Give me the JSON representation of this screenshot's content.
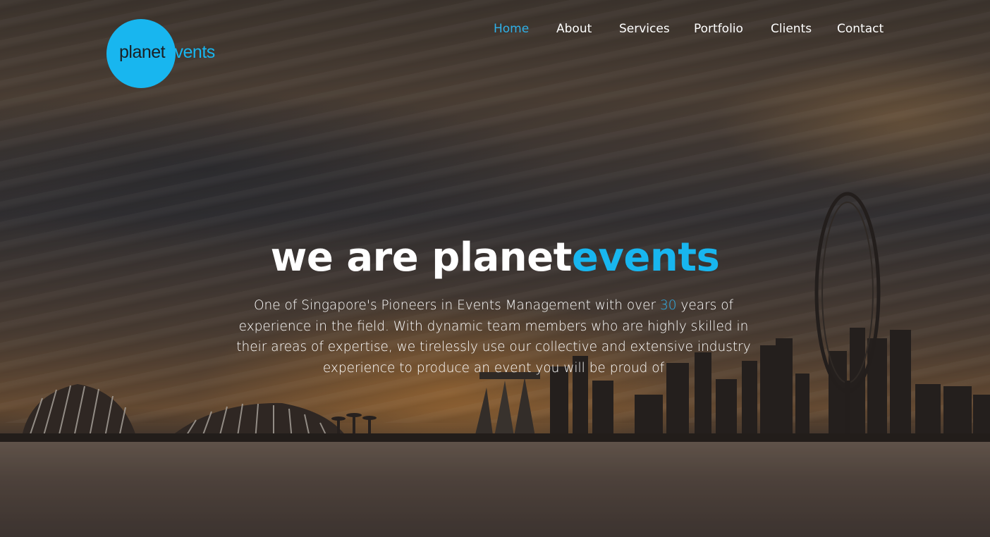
{
  "logo": {
    "text_dark": "planet",
    "text_accent": "events"
  },
  "nav": {
    "items": [
      {
        "label": "Home",
        "active": true
      },
      {
        "label": "About",
        "active": false
      },
      {
        "label": "Services",
        "active": false
      },
      {
        "label": "Portfolio",
        "active": false
      },
      {
        "label": "Clients",
        "active": false
      },
      {
        "label": "Contact",
        "active": false
      }
    ]
  },
  "hero": {
    "headline_main": "we are planet",
    "headline_accent": "events",
    "description_before": "One of Singapore's Pioneers in Events Management with over ",
    "description_number": "30",
    "description_after": " years of experience in the field. With dynamic team members who are highly skilled in their areas of expertise, we tirelessly use our collective and extensive industry experience to produce an event you will be proud of"
  },
  "colors": {
    "accent": "#18b6ef",
    "nav_active": "#2fb0e8",
    "text": "#ffffff",
    "logo_dark": "#1b2024"
  }
}
